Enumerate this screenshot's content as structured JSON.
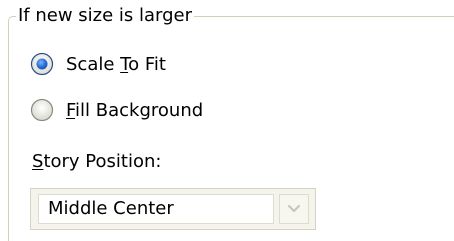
{
  "group": {
    "title": "If new size is larger"
  },
  "options": [
    {
      "label_pre": "Scale ",
      "label_accel": "T",
      "label_post": "o Fit",
      "selected": true
    },
    {
      "label_pre": "",
      "label_accel": "F",
      "label_post": "ill Background",
      "selected": false
    }
  ],
  "story_position": {
    "label_accel": "S",
    "label_post": "tory Position:",
    "value": "Middle Center",
    "enabled": false
  },
  "colors": {
    "group_border": "#d0d0bf",
    "radio_selected": "#2a6fd6",
    "disabled_bg": "#f5f4ec",
    "arrow_disabled": "#c9c7bb"
  },
  "icons": {
    "radio_selected": "radio-selected-icon",
    "radio_unselected": "radio-unselected-icon",
    "dropdown": "chevron-down-icon"
  }
}
